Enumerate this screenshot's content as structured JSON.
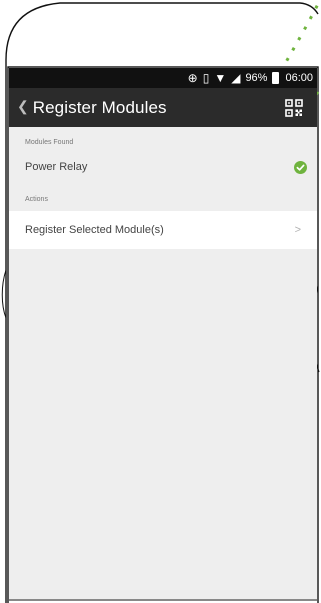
{
  "status_bar": {
    "battery": "96%",
    "time": "06:00"
  },
  "app_bar": {
    "title": "Register Modules",
    "back_icon": "chevron-left",
    "action_icon": "qr-code"
  },
  "modules_section": {
    "header": "Modules Found",
    "items": [
      {
        "label": "Power Relay",
        "status_icon": "check-circle",
        "status_color": "#6fb33e"
      }
    ]
  },
  "actions_section": {
    "header": "Actions",
    "items": [
      {
        "label": "Register Selected Module(s)",
        "chevron": ">"
      }
    ]
  },
  "colors": {
    "accent": "#6fb33e",
    "app_bar": "#2b2b2b",
    "status_bar": "#111111",
    "screen_bg": "#eeeeee"
  }
}
